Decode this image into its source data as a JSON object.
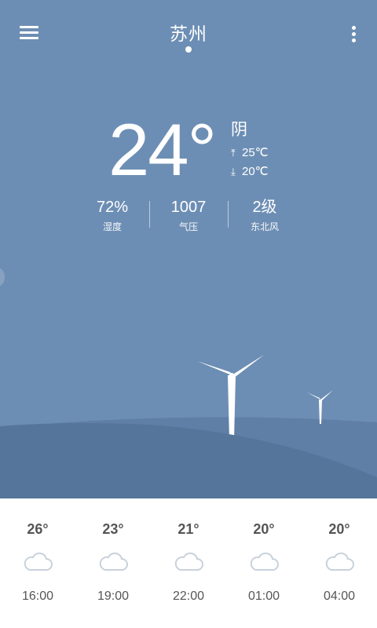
{
  "header": {
    "city": "苏州",
    "menu_icon": "hamburger-menu-icon",
    "more_icon": "more-vertical-icon"
  },
  "current": {
    "temperature": "24°",
    "condition": "阴",
    "high": "25℃",
    "low": "20℃",
    "high_icon": "arrow-up-icon",
    "low_icon": "arrow-down-icon"
  },
  "stats": [
    {
      "value": "72%",
      "label": "湿度"
    },
    {
      "value": "1007",
      "label": "气压"
    },
    {
      "value": "2级",
      "label": "东北风"
    }
  ],
  "forecast": [
    {
      "temp": "26°",
      "time": "16:00",
      "icon": "cloud-icon"
    },
    {
      "temp": "23°",
      "time": "19:00",
      "icon": "cloud-icon"
    },
    {
      "temp": "21°",
      "time": "22:00",
      "icon": "cloud-icon"
    },
    {
      "temp": "20°",
      "time": "01:00",
      "icon": "cloud-icon"
    },
    {
      "temp": "20°",
      "time": "04:00",
      "icon": "cloud-icon"
    }
  ],
  "colors": {
    "sky": "#6d8eb4",
    "hill_back": "#5f7fa6",
    "hill_front": "#55759b",
    "forecast_bg": "#ffffff",
    "text_dark": "#555555",
    "cloud_stroke": "#c9d1db"
  }
}
